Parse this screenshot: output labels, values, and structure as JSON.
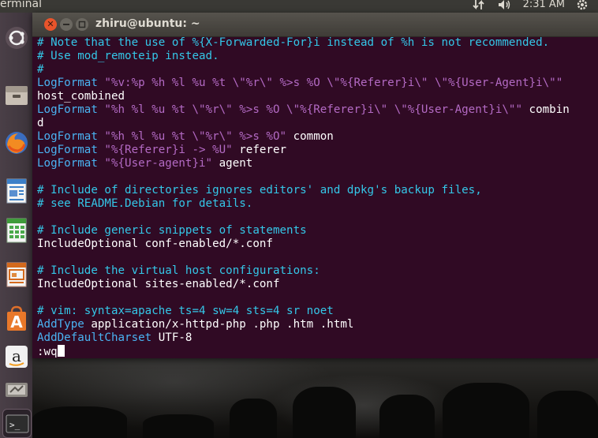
{
  "top_panel": {
    "app_title": "erminal",
    "clock": "2:31 AM",
    "icons": [
      "network-icon",
      "volume-icon",
      "gear-icon"
    ]
  },
  "window": {
    "title": "zhiru@ubuntu: ~",
    "buttons": [
      "close-icon",
      "minimize-icon",
      "maximize-icon"
    ],
    "close_glyph": "✕"
  },
  "launcher": {
    "items": [
      "ubuntu-dash-icon",
      "files-icon",
      "firefox-icon",
      "writer-icon",
      "calc-icon",
      "impress-icon",
      "software-center-icon",
      "amazon-icon",
      "settings-icon",
      "terminal-icon"
    ],
    "amazon_glyph": "a",
    "terminal_glyph": ">_"
  },
  "terminal": {
    "lines": [
      [
        {
          "t": "# Note that the use of %{X-Forwarded-For}i instead of %h is not recommended.",
          "c": "c"
        }
      ],
      [
        {
          "t": "# Use mod_remoteip instead.",
          "c": "c"
        }
      ],
      [
        {
          "t": "#",
          "c": "c"
        }
      ],
      [
        {
          "t": "LogFormat ",
          "c": "k"
        },
        {
          "t": "\"%v:%p %h %l %u %t \\\"%r\\\" %>s %O \\\"%{Referer}i\\\" \\\"%{User-Agent}i\\\"\"",
          "c": "s"
        }
      ],
      [
        {
          "t": "host_combined",
          "c": "w"
        }
      ],
      [
        {
          "t": "LogFormat ",
          "c": "k"
        },
        {
          "t": "\"%h %l %u %t \\\"%r\\\" %>s %O \\\"%{Referer}i\\\" \\\"%{User-Agent}i\\\"\"",
          "c": "s"
        },
        {
          "t": " combin",
          "c": "w"
        }
      ],
      [
        {
          "t": "d",
          "c": "w"
        }
      ],
      [
        {
          "t": "LogFormat ",
          "c": "k"
        },
        {
          "t": "\"%h %l %u %t \\\"%r\\\" %>s %O\"",
          "c": "s"
        },
        {
          "t": " common",
          "c": "w"
        }
      ],
      [
        {
          "t": "LogFormat ",
          "c": "k"
        },
        {
          "t": "\"%{Referer}i -> %U\"",
          "c": "s"
        },
        {
          "t": " referer",
          "c": "w"
        }
      ],
      [
        {
          "t": "LogFormat ",
          "c": "k"
        },
        {
          "t": "\"%{User-agent}i\"",
          "c": "s"
        },
        {
          "t": " agent",
          "c": "w"
        }
      ],
      [
        {
          "t": "",
          "c": "w"
        }
      ],
      [
        {
          "t": "# Include of directories ignores editors' and dpkg's backup files,",
          "c": "c"
        }
      ],
      [
        {
          "t": "# see README.Debian for details.",
          "c": "c"
        }
      ],
      [
        {
          "t": "",
          "c": "w"
        }
      ],
      [
        {
          "t": "# Include generic snippets of statements",
          "c": "c"
        }
      ],
      [
        {
          "t": "IncludeOptional conf-enabled/*.conf",
          "c": "w"
        }
      ],
      [
        {
          "t": "",
          "c": "w"
        }
      ],
      [
        {
          "t": "# Include the virtual host configurations:",
          "c": "c"
        }
      ],
      [
        {
          "t": "IncludeOptional sites-enabled/*.conf",
          "c": "w"
        }
      ],
      [
        {
          "t": "",
          "c": "w"
        }
      ],
      [
        {
          "t": "# vim: syntax=apache ts=4 sw=4 sts=4 sr noet",
          "c": "c"
        }
      ],
      [
        {
          "t": "AddType ",
          "c": "k"
        },
        {
          "t": "application/x-httpd-php .php .htm .html",
          "c": "w"
        }
      ],
      [
        {
          "t": "AddDefaultCharset ",
          "c": "k"
        },
        {
          "t": "UTF-8",
          "c": "w"
        }
      ],
      [
        {
          "t": ":wq",
          "c": "w"
        }
      ]
    ],
    "colors": {
      "background": "#300a24",
      "comment": "#34c7e8",
      "keyword": "#4ab3f2",
      "string": "#b36ac4",
      "text": "#ffffff"
    }
  }
}
